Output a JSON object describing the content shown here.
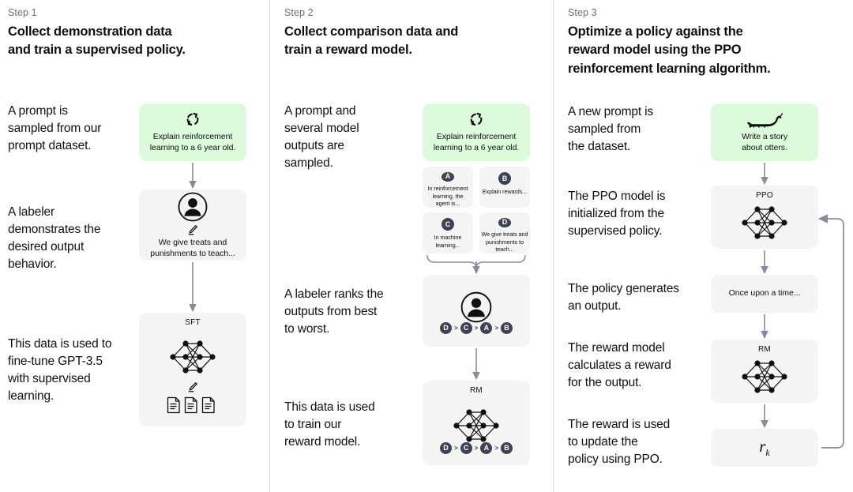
{
  "theme": {
    "green": "#ddfadd",
    "grey": "#f4f4f2",
    "badge": "#3d4254",
    "arrow": "#8b8a9b",
    "divider": "#dcdcdc",
    "text": "#11100f",
    "muted": "#6e6e6e"
  },
  "columns": [
    {
      "step_label": "Step 1",
      "title": "Collect demonstration data\nand train a supervised policy.",
      "descriptions": [
        "A prompt is\nsampled from our\nprompt dataset.",
        "A labeler\ndemonstrates the\ndesired output\nbehavior.",
        "This data is used to\nfine-tune GPT-3.5\nwith supervised\nlearning."
      ],
      "nodes": [
        {
          "kind": "prompt",
          "icon": "refresh-cycle-icon",
          "caption": "Explain reinforcement\nlearning to a 6 year old."
        },
        {
          "kind": "labeler",
          "icon": "person-icon",
          "caption": "We give treats and\npunishments to teach..."
        },
        {
          "kind": "network",
          "label": "SFT",
          "icon": "documents-icon"
        }
      ]
    },
    {
      "step_label": "Step 2",
      "title": "Collect comparison data and\ntrain a reward model.",
      "descriptions": [
        "A prompt and\nseveral model\noutputs are\nsampled.",
        "A labeler ranks the\noutputs from best\nto worst.",
        "This data is used\nto train our\nreward model."
      ],
      "nodes": [
        {
          "kind": "prompt",
          "icon": "refresh-cycle-icon",
          "caption": "Explain reinforcement\nlearning to a 6 year old."
        },
        {
          "kind": "options",
          "items": [
            {
              "letter": "A",
              "text": "In reinforcement\nlearning, the\nagent is..."
            },
            {
              "letter": "B",
              "text": "Explain rewards..."
            },
            {
              "letter": "C",
              "text": "In machine\nlearning..."
            },
            {
              "letter": "D",
              "text": "We give treats and\npunishments to\nteach..."
            }
          ]
        },
        {
          "kind": "ranker",
          "icon": "person-icon",
          "ranking": [
            "D",
            "C",
            "A",
            "B"
          ],
          "separator": ">"
        },
        {
          "kind": "network",
          "label": "RM",
          "ranking": [
            "D",
            "C",
            "A",
            "B"
          ],
          "separator": ">"
        }
      ]
    },
    {
      "step_label": "Step 3",
      "title": "Optimize a policy against the\nreward model using the PPO\nreinforcement learning algorithm.",
      "descriptions": [
        "A new prompt is\nsampled from\nthe dataset.",
        "The PPO model is\ninitialized from the\nsupervised policy.",
        "The policy generates\nan output.",
        "The reward model\ncalculates a reward\nfor the output.",
        "The reward is used\nto update the\npolicy using PPO."
      ],
      "nodes": [
        {
          "kind": "prompt",
          "icon": "otter-icon",
          "caption": "Write a story\nabout otters."
        },
        {
          "kind": "network",
          "label": "PPO"
        },
        {
          "kind": "text",
          "caption": "Once upon a time..."
        },
        {
          "kind": "network",
          "label": "RM"
        },
        {
          "kind": "reward",
          "symbol": "r",
          "subscript": "k"
        }
      ]
    }
  ]
}
